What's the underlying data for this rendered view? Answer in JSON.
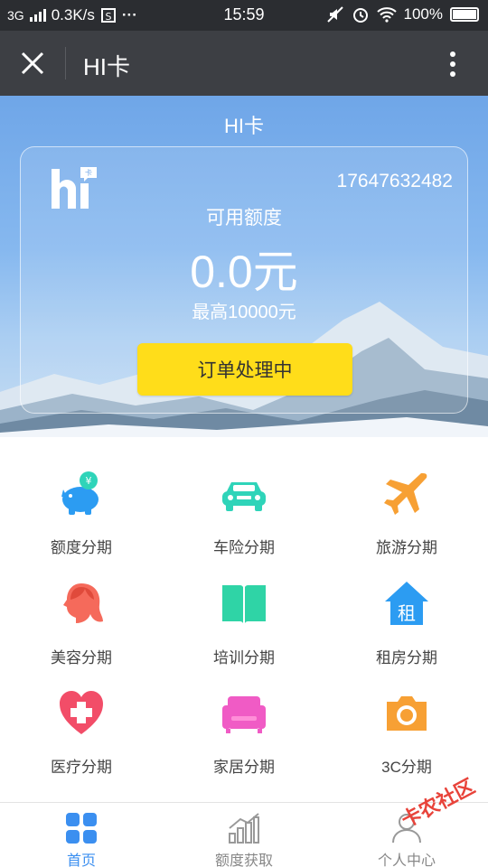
{
  "status": {
    "network": "3G",
    "speed": "0.3K/s",
    "more": "···",
    "time": "15:59",
    "battery": "100%"
  },
  "header": {
    "title": "HI卡"
  },
  "hero": {
    "title": "HI卡",
    "phone": "17647632482",
    "available_label": "可用额度",
    "amount": "0.0元",
    "max_label": "最高10000元",
    "button_label": "订单处理中"
  },
  "services": [
    {
      "label": "额度分期",
      "icon": "piggy-bank-icon",
      "color": "#2c9cf2"
    },
    {
      "label": "车险分期",
      "icon": "car-icon",
      "color": "#2fd4b9"
    },
    {
      "label": "旅游分期",
      "icon": "airplane-icon",
      "color": "#f7a034"
    },
    {
      "label": "美容分期",
      "icon": "woman-face-icon",
      "color": "#f56a5b"
    },
    {
      "label": "培训分期",
      "icon": "book-icon",
      "color": "#2fd4a6"
    },
    {
      "label": "租房分期",
      "icon": "house-icon",
      "color": "#2c9cf2",
      "glyph": "租"
    },
    {
      "label": "医疗分期",
      "icon": "medical-heart-icon",
      "color": "#f24d68"
    },
    {
      "label": "家居分期",
      "icon": "sofa-icon",
      "color": "#f05bc5"
    },
    {
      "label": "3C分期",
      "icon": "camera-icon",
      "color": "#f7a034"
    }
  ],
  "nav": [
    {
      "label": "首页",
      "icon": "home-grid-icon",
      "active": true
    },
    {
      "label": "额度获取",
      "icon": "bar-chart-icon",
      "active": false
    },
    {
      "label": "个人中心",
      "icon": "person-icon",
      "active": false
    }
  ],
  "watermark": "卡农社区"
}
